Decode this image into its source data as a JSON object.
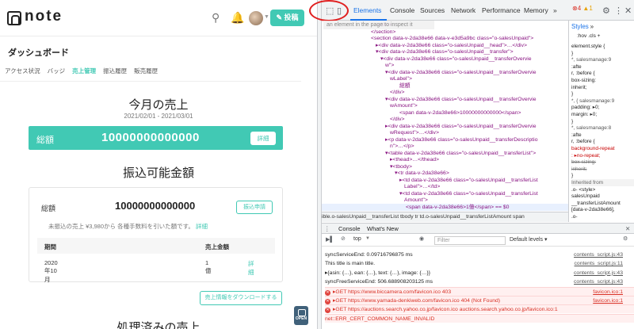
{
  "note_app": {
    "logo": "note",
    "post_button": "投稿",
    "page_title": "ダッシュボード",
    "tabs": [
      "アクセス状況",
      "バッジ",
      "売上管理",
      "振込履歴",
      "販売履歴"
    ],
    "active_tab_index": 2,
    "monthly_sales": {
      "title": "今月の売上",
      "range": "2021/02/01 - 2021/03/01",
      "total_label": "総額",
      "total_amount": "10000000000000",
      "detail_button": "詳細"
    },
    "transferable": {
      "title": "振込可能金額",
      "total_label": "総額",
      "total_amount": "10000000000000",
      "apply_button": "振込申請",
      "note_text": "未振込の売上 ¥3,980から 各種手数料を引いた額です。",
      "note_link": "詳細",
      "table_headers": [
        "期間",
        "売上金額"
      ],
      "rows": [
        {
          "period": "2020年10月",
          "amount": "1億",
          "link": "詳細"
        }
      ]
    },
    "download_button": "売上情報をダウンロードする",
    "open_badge": "OPEN",
    "processed_title": "処理済みの売上"
  },
  "devtools": {
    "tabs": [
      "Elements",
      "Console",
      "Sources",
      "Network",
      "Performance",
      "Memory",
      "»"
    ],
    "active_tab": "Elements",
    "error_count": "4",
    "warn_count": "1",
    "inspect_tooltip": "an element in the page to inspect it",
    "elements_lines": [
      {
        "t": "</div>"
      },
      {
        "t": "</section>"
      },
      {
        "t": "<section data-v-2da38e66 data-v-e3d5a9bc class=\"o-salesUnpaid\">"
      },
      {
        "t": "▸<div data-v-2da38e66 class=\"o-salesUnpaid__head\">…</div>"
      },
      {
        "t": "▾<div data-v-2da38e66 class=\"o-salesUnpaid__transfer\">"
      },
      {
        "t": "▾<div data-v-2da38e66 class=\"o-salesUnpaid__transferOvervie"
      },
      {
        "t": "w\">"
      },
      {
        "t": "▾<div data-v-2da38e66 class=\"o-salesUnpaid__transferOvervie"
      },
      {
        "t": "wLabel\">"
      },
      {
        "t": "総額"
      },
      {
        "t": "</div>"
      },
      {
        "t": "▾<div data-v-2da38e66 class=\"o-salesUnpaid__transferOvervie"
      },
      {
        "t": "wAmount\">"
      },
      {
        "t": "<span data-v-2da38e66>10000000000000</span>"
      },
      {
        "t": "</div>"
      },
      {
        "t": "▸<div data-v-2da38e66 class=\"o-salesUnpaid__transferOvervie"
      },
      {
        "t": "wRequest\">…</div>"
      },
      {
        "t": "▸<p data-v-2da38e66 class=\"o-salesUnpaid__transferDescriptio"
      },
      {
        "t": "n\">…</p>"
      },
      {
        "t": "▾<table data-v-2da38e66 class=\"o-salesUnpaid__transferList\">"
      },
      {
        "t": "▸<thead>…</thead>"
      },
      {
        "t": "▾<tbody>"
      },
      {
        "t": "▾<tr data-v-2da38e66>"
      },
      {
        "t": "▸<td data-v-2da38e66 class=\"o-salesUnpaid__transferList"
      },
      {
        "t": "Label\">…</td>"
      },
      {
        "t": "▾<td data-v-2da38e66 class=\"o-salesUnpaid__transferList"
      },
      {
        "t": "Amount\">"
      },
      {
        "t": "<span data-v-2da38e66>1億</span> == $0"
      }
    ],
    "breadcrumb": "ible.o-salesUnpaid__transferList   tbody   tr   td.o-salesUnpaid__transferListAmount   span",
    "styles": {
      "tabs": [
        "Styles",
        "»"
      ],
      "filter_items": [
        ":hov",
        ".cls",
        "+"
      ],
      "rules": [
        "element.style {",
        "}",
        "*,    salesmanage:9",
        ":afte",
        "r, :before {",
        "  box-sizing:",
        "    inherit;",
        "}",
        "*, {    salesmanage:9",
        "  padding: ▸0;",
        "  margin: ▸0;",
        "}",
        "*,    salesmanage:8",
        ":afte",
        "r, :before {",
        "  background-repeat",
        "    : ▸no-repeat;",
        "  box-sizing:",
        "    inherit;",
        "}",
        "Inherited from",
        ".o-        <style>",
        "salesUnpaid",
        "__transferListAmount",
        "[data-v-2da38e66],",
        ".o-"
      ]
    },
    "console": {
      "tabs": [
        "Console",
        "What's New"
      ],
      "context": "top",
      "filter_placeholder": "Filter",
      "levels": "Default levels ▾",
      "logs": [
        {
          "type": "log",
          "text": "syncServiceEnd: 0.09716796875 ms",
          "src": "contents_script.js:43"
        },
        {
          "type": "log",
          "text": "This title is main title.",
          "src": "contents_script.js:11"
        },
        {
          "type": "log",
          "text": "▸{asin: {…}, ean: {…}, text: {…}, image: {…}}",
          "src": "contents_script.js:43"
        },
        {
          "type": "log",
          "text": "syncFreeServiceEnd: 506.688908203125 ms",
          "src": "contents_script.js:43"
        },
        {
          "type": "err",
          "text": "▸GET https://www.biccamera.com/favicon.ico 403",
          "src": "favicon.ico:1"
        },
        {
          "type": "err",
          "text": "▸GET https://www.yamada-denkiweb.com/favicon.ico 404 (Not Found)",
          "src": "favicon.ico:1"
        },
        {
          "type": "err",
          "text": "▸GET https://auctions.search.yahoo.co.jp/favicon.ico   auctions.search.yahoo.co.jp/favicon.ico:1",
          "src": ""
        },
        {
          "type": "err",
          "text": "net::ERR_CERT_COMMON_NAME_INVALID",
          "src": ""
        }
      ]
    }
  }
}
